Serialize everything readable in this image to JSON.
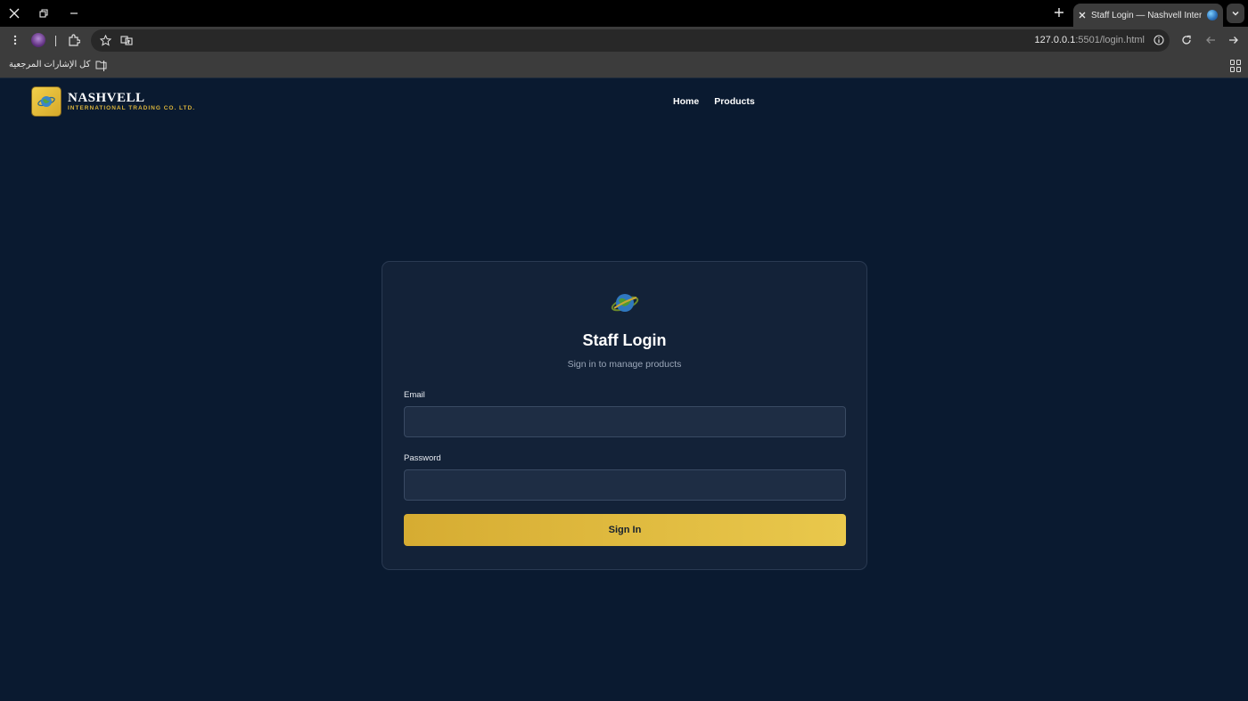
{
  "browser": {
    "tab_title": "Staff Login — Nashvell Internati",
    "url_host": "127.0.0.1",
    "url_path": ":5501/login.html",
    "bookmarks_folder_label": "كل الإشارات المرجعية"
  },
  "header": {
    "brand_name": "NASHVELL",
    "brand_subtitle": "INTERNATIONAL TRADING CO. LTD.",
    "nav": [
      {
        "label": "Home"
      },
      {
        "label": "Products"
      }
    ]
  },
  "login": {
    "title": "Staff Login",
    "subtitle": "Sign in to manage products",
    "email_label": "Email",
    "email_value": "",
    "password_label": "Password",
    "password_value": "",
    "submit_label": "Sign In"
  },
  "colors": {
    "page_background": "#0a1a30",
    "card_background": "#132238",
    "accent_gold": "#e3bd40",
    "input_background": "#1e2d44"
  },
  "icons": {
    "logo": "globe-icon",
    "card": "globe-icon"
  }
}
